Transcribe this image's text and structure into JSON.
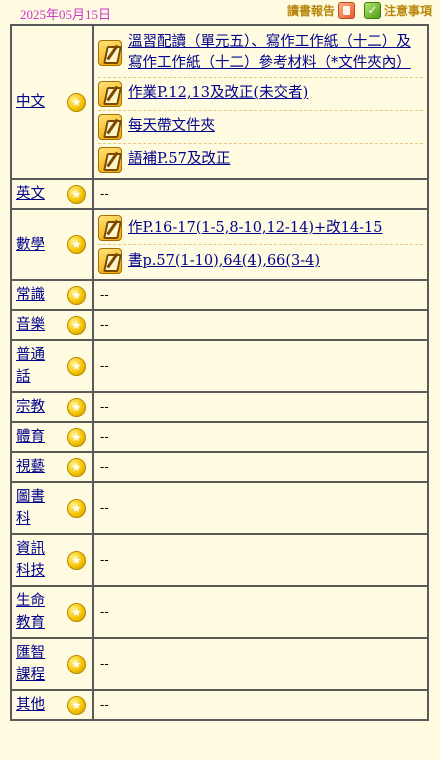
{
  "header": {
    "date": "2025年05月15日",
    "reading_report_label": "讀書報告",
    "notice_label": "注意事項",
    "report_icon": "report-book-icon",
    "notice_icon": "notice-check-icon"
  },
  "colors": {
    "background": "#fffbe0",
    "date": "#cc33cc",
    "link": "#00008b",
    "border": "#5a5a5a",
    "dash_divider": "#e6c97a"
  },
  "subjects": [
    {
      "name": "中文",
      "icon": "star-icon",
      "items": [
        "溫習配讀（單元五）、寫作工作紙（十二）及寫作工作紙（十二）參考材料（*文件夾內）",
        "作業P.12,13及改正(未交者)",
        "每天帶文件夾",
        "語補P.57及改正"
      ]
    },
    {
      "name": "英文",
      "icon": "star-icon",
      "items": [],
      "empty": "--"
    },
    {
      "name": "數學",
      "icon": "star-icon",
      "items": [
        "作P.16-17(1-5,8-10,12-14)+改14-15",
        "書p.57(1-10),64(4),66(3-4)"
      ]
    },
    {
      "name": "常識",
      "icon": "star-icon",
      "items": [],
      "empty": "--"
    },
    {
      "name": "音樂",
      "icon": "star-icon",
      "items": [],
      "empty": "--"
    },
    {
      "name": "普通話",
      "icon": "star-icon",
      "items": [],
      "empty": "--"
    },
    {
      "name": "宗教",
      "icon": "star-icon",
      "items": [],
      "empty": "--"
    },
    {
      "name": "體育",
      "icon": "star-icon",
      "items": [],
      "empty": "--"
    },
    {
      "name": "視藝",
      "icon": "star-icon",
      "items": [],
      "empty": "--"
    },
    {
      "name": "圖書科",
      "icon": "star-icon",
      "items": [],
      "empty": "--"
    },
    {
      "name": "資訊科技",
      "icon": "star-icon",
      "items": [],
      "empty": "--"
    },
    {
      "name": "生命教育",
      "icon": "star-icon",
      "items": [],
      "empty": "--"
    },
    {
      "name": "匯智課程",
      "icon": "star-icon",
      "items": [],
      "empty": "--"
    },
    {
      "name": "其他",
      "icon": "star-icon",
      "items": [],
      "empty": "--"
    }
  ],
  "homework_item_icon": "homework-pencil-icon"
}
